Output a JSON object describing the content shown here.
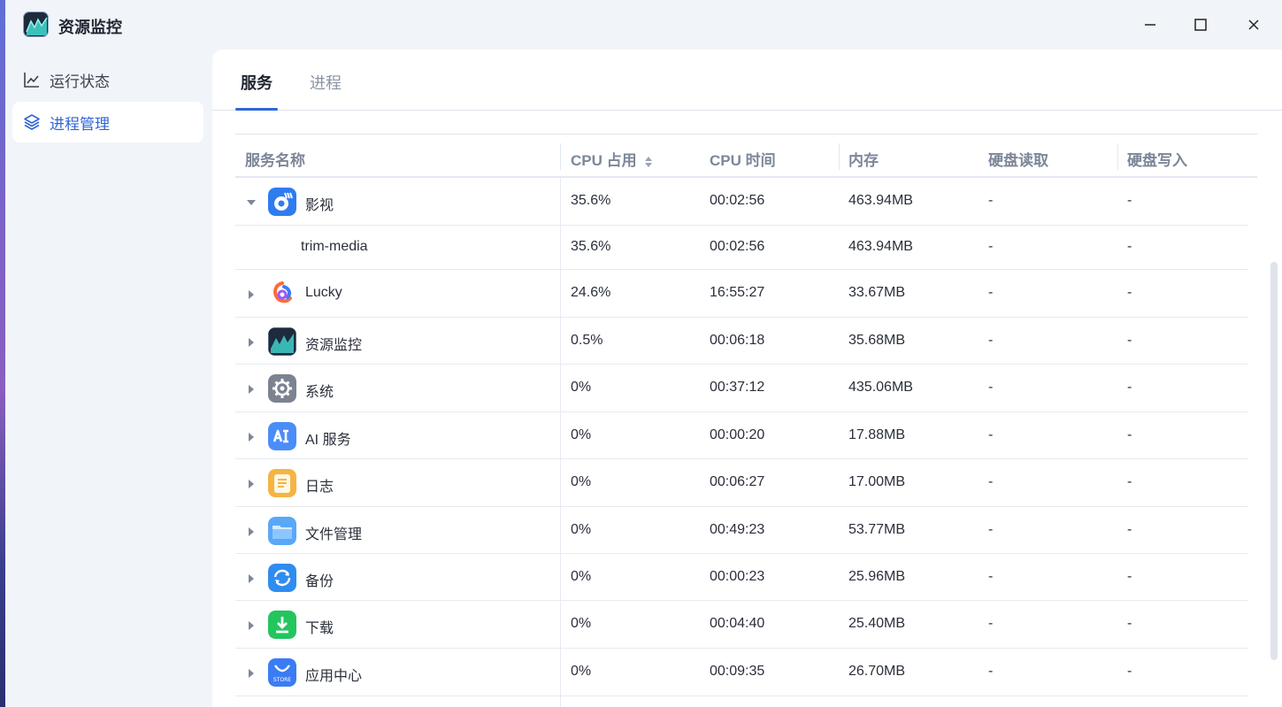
{
  "window": {
    "title": "资源监控",
    "controls": {
      "minimize": "minimize-icon",
      "maximize": "maximize-icon",
      "close": "close-icon"
    }
  },
  "sidebar": {
    "items": [
      {
        "label": "运行状态",
        "icon": "line-chart-icon",
        "active": false
      },
      {
        "label": "进程管理",
        "icon": "layers-icon",
        "active": true
      }
    ]
  },
  "tabs": [
    {
      "label": "服务",
      "active": true
    },
    {
      "label": "进程",
      "active": false
    }
  ],
  "table": {
    "columns": [
      "服务名称",
      "CPU 占用",
      "CPU 时间",
      "内存",
      "硬盘读取",
      "硬盘写入"
    ],
    "rows": [
      {
        "name": "影视",
        "cpu": "35.6%",
        "time": "00:02:56",
        "mem": "463.94MB",
        "read": "-",
        "write": "-",
        "expanded": true,
        "icon": "video-app-icon"
      },
      {
        "name": "trim-media",
        "cpu": "35.6%",
        "time": "00:02:56",
        "mem": "463.94MB",
        "read": "-",
        "write": "-",
        "child": true
      },
      {
        "name": "Lucky",
        "cpu": "24.6%",
        "time": "16:55:27",
        "mem": "33.67MB",
        "read": "-",
        "write": "-",
        "icon": "lucky-app-icon"
      },
      {
        "name": "资源监控",
        "cpu": "0.5%",
        "time": "00:06:18",
        "mem": "35.68MB",
        "read": "-",
        "write": "-",
        "icon": "monitor-app-icon"
      },
      {
        "name": "系统",
        "cpu": "0%",
        "time": "00:37:12",
        "mem": "435.06MB",
        "read": "-",
        "write": "-",
        "icon": "system-gear-icon"
      },
      {
        "name": "AI 服务",
        "cpu": "0%",
        "time": "00:00:20",
        "mem": "17.88MB",
        "read": "-",
        "write": "-",
        "icon": "ai-app-icon"
      },
      {
        "name": "日志",
        "cpu": "0%",
        "time": "00:06:27",
        "mem": "17.00MB",
        "read": "-",
        "write": "-",
        "icon": "log-app-icon"
      },
      {
        "name": "文件管理",
        "cpu": "0%",
        "time": "00:49:23",
        "mem": "53.77MB",
        "read": "-",
        "write": "-",
        "icon": "folder-app-icon"
      },
      {
        "name": "备份",
        "cpu": "0%",
        "time": "00:00:23",
        "mem": "25.96MB",
        "read": "-",
        "write": "-",
        "icon": "backup-app-icon"
      },
      {
        "name": "下载",
        "cpu": "0%",
        "time": "00:04:40",
        "mem": "25.40MB",
        "read": "-",
        "write": "-",
        "icon": "download-app-icon"
      },
      {
        "name": "应用中心",
        "cpu": "0%",
        "time": "00:09:35",
        "mem": "26.70MB",
        "read": "-",
        "write": "-",
        "icon": "store-app-icon",
        "icon_text": "STORE"
      }
    ]
  },
  "colors": {
    "accent": "#2f66d8",
    "background": "#f1f4f9"
  }
}
